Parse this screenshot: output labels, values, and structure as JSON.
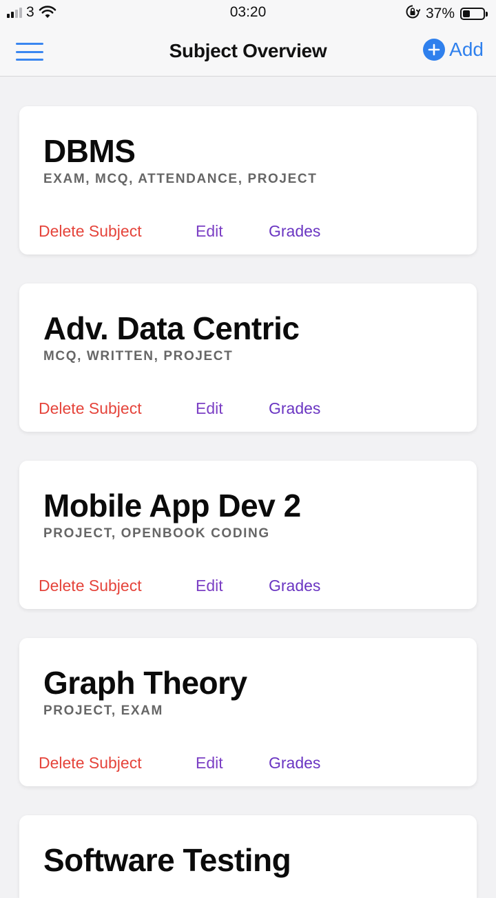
{
  "status_bar": {
    "carrier": "3",
    "time": "03:20",
    "battery_percent": "37%",
    "battery_level": 0.37,
    "icons": [
      "signal-icon",
      "wifi-icon",
      "orientation-lock-icon",
      "battery-icon"
    ]
  },
  "nav": {
    "title": "Subject Overview",
    "add_label": "Add",
    "menu_icon": "hamburger-menu-icon",
    "add_icon": "plus-circle-icon"
  },
  "colors": {
    "accent_blue": "#2f80ed",
    "delete_red": "#e5443b",
    "action_purple": "#7b3fc4"
  },
  "subjects": [
    {
      "name": "DBMS",
      "tags": "EXAM, MCQ, ATTENDANCE, PROJECT",
      "delete_label": "Delete Subject",
      "edit_label": "Edit",
      "grades_label": "Grades"
    },
    {
      "name": "Adv. Data Centric",
      "tags": "MCQ, WRITTEN, PROJECT",
      "delete_label": "Delete Subject",
      "edit_label": "Edit",
      "grades_label": "Grades"
    },
    {
      "name": "Mobile App Dev 2",
      "tags": "PROJECT, OPENBOOK CODING",
      "delete_label": "Delete Subject",
      "edit_label": "Edit",
      "grades_label": "Grades"
    },
    {
      "name": "Graph Theory",
      "tags": "PROJECT, EXAM",
      "delete_label": "Delete Subject",
      "edit_label": "Edit",
      "grades_label": "Grades"
    },
    {
      "name": "Software Testing"
    }
  ]
}
